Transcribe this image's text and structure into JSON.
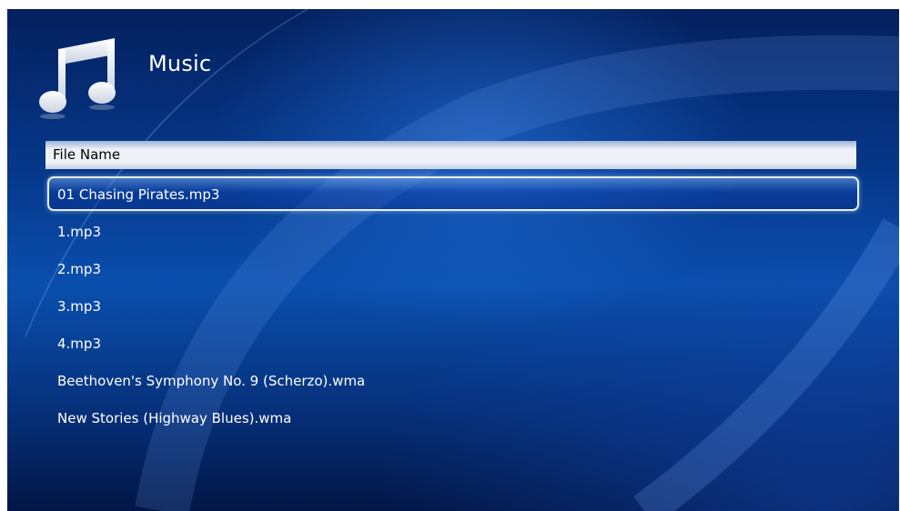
{
  "header": {
    "icon": "music-note-icon",
    "title": "Music"
  },
  "column_header": {
    "label": "File Name"
  },
  "files": [
    {
      "name": "01 Chasing Pirates.mp3",
      "selected": true
    },
    {
      "name": "1.mp3",
      "selected": false
    },
    {
      "name": "2.mp3",
      "selected": false
    },
    {
      "name": "3.mp3",
      "selected": false
    },
    {
      "name": "4.mp3",
      "selected": false
    },
    {
      "name": "Beethoven's Symphony No. 9 (Scherzo).wma",
      "selected": false
    },
    {
      "name": "New Stories (Highway Blues).wma",
      "selected": false
    }
  ],
  "colors": {
    "background": "#0a4fae",
    "selection_border": "#e6eefc",
    "text": "#ffffff"
  }
}
